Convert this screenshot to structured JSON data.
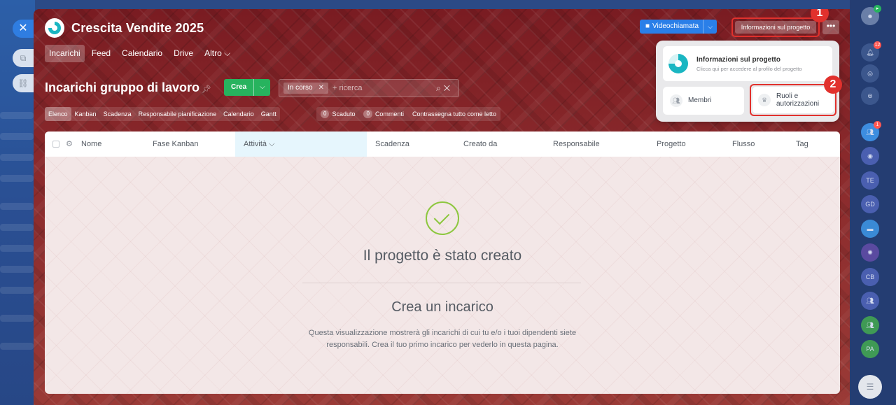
{
  "project": {
    "title": "Crescita Vendite 2025"
  },
  "main_tabs": [
    "Incarichi",
    "Feed",
    "Calendario",
    "Drive",
    "Altro ⌵"
  ],
  "header_buttons": {
    "video": "Videochiamata",
    "info": "Informazioni sul progetto",
    "more": "•••"
  },
  "steps": [
    "1",
    "2"
  ],
  "popup": {
    "info_title": "Informazioni sul progetto",
    "info_desc": "Clicca qui per accedere al profilo del progetto",
    "members": "Membri",
    "roles": "Ruoli e autorizzazioni"
  },
  "tasks": {
    "title": "Incarichi gruppo di lavoro",
    "create": "Crea",
    "filter_chip": "In corso",
    "search_placeholder": "+ ricerca"
  },
  "view_tabs": [
    "Elenco",
    "Kanban",
    "Scadenza",
    "Responsabile pianificazione",
    "Calendario",
    "Gantt"
  ],
  "counters": {
    "overdue_count": "0",
    "overdue_label": "Scaduto",
    "comments_count": "0",
    "comments_label": "Commenti",
    "mark_read": "Contrassegna tutto come letto"
  },
  "columns": [
    "Nome",
    "Fase Kanban",
    "Attività ⌵",
    "Scadenza",
    "Creato da",
    "Responsabile",
    "Progetto",
    "Flusso",
    "Tag"
  ],
  "empty_state": {
    "title": "Il progetto è stato creato",
    "subtitle": "Crea un incarico",
    "desc": "Questa visualizzazione mostrerà gli incarichi di cui tu e/o i tuoi dipendenti siete responsabili. Crea il tuo primo incarico per vederlo in questa pagina."
  },
  "rail": {
    "notifications_badge": "12",
    "group_badge": "1",
    "avatars": [
      "TE",
      "GD",
      "CB",
      "PA"
    ]
  },
  "colors": {
    "accent_red": "#e1312d",
    "create_green": "#27b35e",
    "video_blue": "#2a7fe8",
    "success_green": "#8dc73f"
  }
}
